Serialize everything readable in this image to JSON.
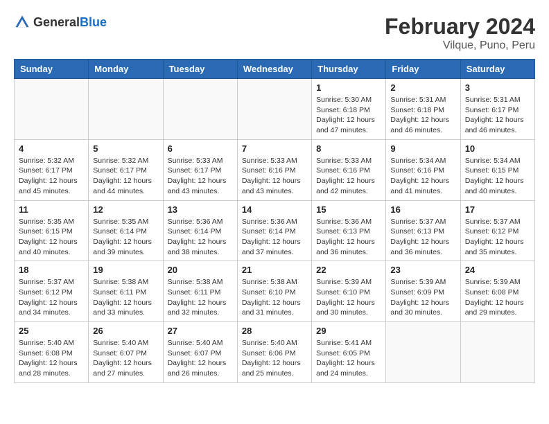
{
  "header": {
    "logo_general": "General",
    "logo_blue": "Blue",
    "main_title": "February 2024",
    "subtitle": "Vilque, Puno, Peru"
  },
  "days_of_week": [
    "Sunday",
    "Monday",
    "Tuesday",
    "Wednesday",
    "Thursday",
    "Friday",
    "Saturday"
  ],
  "weeks": [
    [
      {
        "day": "",
        "info": ""
      },
      {
        "day": "",
        "info": ""
      },
      {
        "day": "",
        "info": ""
      },
      {
        "day": "",
        "info": ""
      },
      {
        "day": "1",
        "info": "Sunrise: 5:30 AM\nSunset: 6:18 PM\nDaylight: 12 hours\nand 47 minutes."
      },
      {
        "day": "2",
        "info": "Sunrise: 5:31 AM\nSunset: 6:18 PM\nDaylight: 12 hours\nand 46 minutes."
      },
      {
        "day": "3",
        "info": "Sunrise: 5:31 AM\nSunset: 6:17 PM\nDaylight: 12 hours\nand 46 minutes."
      }
    ],
    [
      {
        "day": "4",
        "info": "Sunrise: 5:32 AM\nSunset: 6:17 PM\nDaylight: 12 hours\nand 45 minutes."
      },
      {
        "day": "5",
        "info": "Sunrise: 5:32 AM\nSunset: 6:17 PM\nDaylight: 12 hours\nand 44 minutes."
      },
      {
        "day": "6",
        "info": "Sunrise: 5:33 AM\nSunset: 6:17 PM\nDaylight: 12 hours\nand 43 minutes."
      },
      {
        "day": "7",
        "info": "Sunrise: 5:33 AM\nSunset: 6:16 PM\nDaylight: 12 hours\nand 43 minutes."
      },
      {
        "day": "8",
        "info": "Sunrise: 5:33 AM\nSunset: 6:16 PM\nDaylight: 12 hours\nand 42 minutes."
      },
      {
        "day": "9",
        "info": "Sunrise: 5:34 AM\nSunset: 6:16 PM\nDaylight: 12 hours\nand 41 minutes."
      },
      {
        "day": "10",
        "info": "Sunrise: 5:34 AM\nSunset: 6:15 PM\nDaylight: 12 hours\nand 40 minutes."
      }
    ],
    [
      {
        "day": "11",
        "info": "Sunrise: 5:35 AM\nSunset: 6:15 PM\nDaylight: 12 hours\nand 40 minutes."
      },
      {
        "day": "12",
        "info": "Sunrise: 5:35 AM\nSunset: 6:14 PM\nDaylight: 12 hours\nand 39 minutes."
      },
      {
        "day": "13",
        "info": "Sunrise: 5:36 AM\nSunset: 6:14 PM\nDaylight: 12 hours\nand 38 minutes."
      },
      {
        "day": "14",
        "info": "Sunrise: 5:36 AM\nSunset: 6:14 PM\nDaylight: 12 hours\nand 37 minutes."
      },
      {
        "day": "15",
        "info": "Sunrise: 5:36 AM\nSunset: 6:13 PM\nDaylight: 12 hours\nand 36 minutes."
      },
      {
        "day": "16",
        "info": "Sunrise: 5:37 AM\nSunset: 6:13 PM\nDaylight: 12 hours\nand 36 minutes."
      },
      {
        "day": "17",
        "info": "Sunrise: 5:37 AM\nSunset: 6:12 PM\nDaylight: 12 hours\nand 35 minutes."
      }
    ],
    [
      {
        "day": "18",
        "info": "Sunrise: 5:37 AM\nSunset: 6:12 PM\nDaylight: 12 hours\nand 34 minutes."
      },
      {
        "day": "19",
        "info": "Sunrise: 5:38 AM\nSunset: 6:11 PM\nDaylight: 12 hours\nand 33 minutes."
      },
      {
        "day": "20",
        "info": "Sunrise: 5:38 AM\nSunset: 6:11 PM\nDaylight: 12 hours\nand 32 minutes."
      },
      {
        "day": "21",
        "info": "Sunrise: 5:38 AM\nSunset: 6:10 PM\nDaylight: 12 hours\nand 31 minutes."
      },
      {
        "day": "22",
        "info": "Sunrise: 5:39 AM\nSunset: 6:10 PM\nDaylight: 12 hours\nand 30 minutes."
      },
      {
        "day": "23",
        "info": "Sunrise: 5:39 AM\nSunset: 6:09 PM\nDaylight: 12 hours\nand 30 minutes."
      },
      {
        "day": "24",
        "info": "Sunrise: 5:39 AM\nSunset: 6:08 PM\nDaylight: 12 hours\nand 29 minutes."
      }
    ],
    [
      {
        "day": "25",
        "info": "Sunrise: 5:40 AM\nSunset: 6:08 PM\nDaylight: 12 hours\nand 28 minutes."
      },
      {
        "day": "26",
        "info": "Sunrise: 5:40 AM\nSunset: 6:07 PM\nDaylight: 12 hours\nand 27 minutes."
      },
      {
        "day": "27",
        "info": "Sunrise: 5:40 AM\nSunset: 6:07 PM\nDaylight: 12 hours\nand 26 minutes."
      },
      {
        "day": "28",
        "info": "Sunrise: 5:40 AM\nSunset: 6:06 PM\nDaylight: 12 hours\nand 25 minutes."
      },
      {
        "day": "29",
        "info": "Sunrise: 5:41 AM\nSunset: 6:05 PM\nDaylight: 12 hours\nand 24 minutes."
      },
      {
        "day": "",
        "info": ""
      },
      {
        "day": "",
        "info": ""
      }
    ]
  ]
}
